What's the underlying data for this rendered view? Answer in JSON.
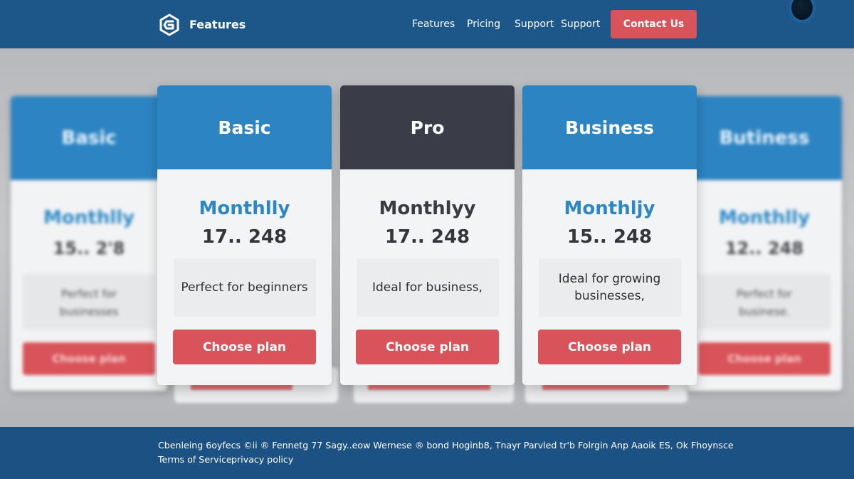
{
  "header": {
    "brand": "Features",
    "nav": [
      "Features",
      "Pricing",
      "Support",
      "Support"
    ],
    "cta_label": "Contact Us"
  },
  "background_cards": [
    {
      "title": "Basic",
      "period": "Monthlly",
      "price": "15.. 2'8",
      "desc_line1": "Perfect for",
      "desc_line2": "businesses",
      "button": "Choose plan"
    },
    {
      "title": "Butiness",
      "period": "Monthlly",
      "price": "12.. 248",
      "desc_line1": "Perfect for",
      "desc_line2": "businese.",
      "button": "Choose plan"
    }
  ],
  "plans": [
    {
      "title": "Basic",
      "period": "Monthlly",
      "price": "17.. 248",
      "description": "Perfect for beginners",
      "button": "Choose plan",
      "head_color": "#2d84c2",
      "period_color": "#2e86c3"
    },
    {
      "title": "Pro",
      "period": "Monthlyy",
      "price": "17.. 248",
      "description": "Ideal for business,",
      "button": "Choose plan",
      "head_color": "#3a3d47",
      "period_color": "#3a3b40"
    },
    {
      "title": "Business",
      "period": "Monthljy",
      "price": "15.. 248",
      "description": "Ideal for growing businesses,",
      "button": "Choose plan",
      "head_color": "#2d84c2",
      "period_color": "#2e86c3"
    }
  ],
  "footer": {
    "line1": "Cbenleing 6oyfecs ©ii ® Fennetg 77 Sagy..eow Wernese ® bond Hoginb8, Tnayr Parvled tr'b Folrgin Anp Aaoik ES, Ok Fhoynsce",
    "terms": "Terms of Service",
    "privacy": "privacy policy"
  },
  "colors": {
    "header_bg": "#1d5688",
    "accent_red": "#d9545a",
    "plan_blue": "#2d84c2",
    "plan_dark": "#3a3d47",
    "footer_bg": "#1c5183"
  }
}
